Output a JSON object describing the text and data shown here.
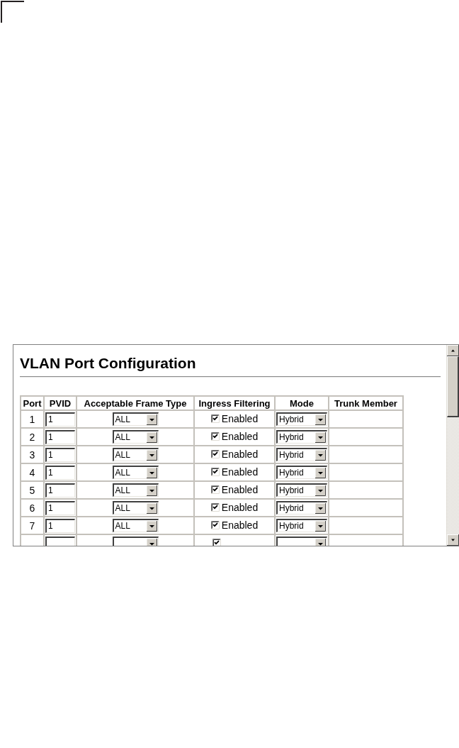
{
  "heading": "VLAN Port Configuration",
  "table": {
    "columns": [
      "Port",
      "PVID",
      "Acceptable Frame Type",
      "Ingress Filtering",
      "Mode",
      "Trunk Member"
    ],
    "rows": [
      {
        "port": "1",
        "pvid": "1",
        "frame_type": "ALL",
        "ingress_filtering": {
          "label": "Enabled",
          "checked": true
        },
        "mode": "Hybrid"
      },
      {
        "port": "2",
        "pvid": "1",
        "frame_type": "ALL",
        "ingress_filtering": {
          "label": "Enabled",
          "checked": true
        },
        "mode": "Hybrid"
      },
      {
        "port": "3",
        "pvid": "1",
        "frame_type": "ALL",
        "ingress_filtering": {
          "label": "Enabled",
          "checked": true
        },
        "mode": "Hybrid"
      },
      {
        "port": "4",
        "pvid": "1",
        "frame_type": "ALL",
        "ingress_filtering": {
          "label": "Enabled",
          "checked": true
        },
        "mode": "Hybrid"
      },
      {
        "port": "5",
        "pvid": "1",
        "frame_type": "ALL",
        "ingress_filtering": {
          "label": "Enabled",
          "checked": true
        },
        "mode": "Hybrid"
      },
      {
        "port": "6",
        "pvid": "1",
        "frame_type": "ALL",
        "ingress_filtering": {
          "label": "Enabled",
          "checked": true
        },
        "mode": "Hybrid"
      },
      {
        "port": "7",
        "pvid": "1",
        "frame_type": "ALL",
        "ingress_filtering": {
          "label": "Enabled",
          "checked": true
        },
        "mode": "Hybrid"
      },
      {
        "ingress_filtering": {
          "checked": true
        }
      }
    ]
  }
}
